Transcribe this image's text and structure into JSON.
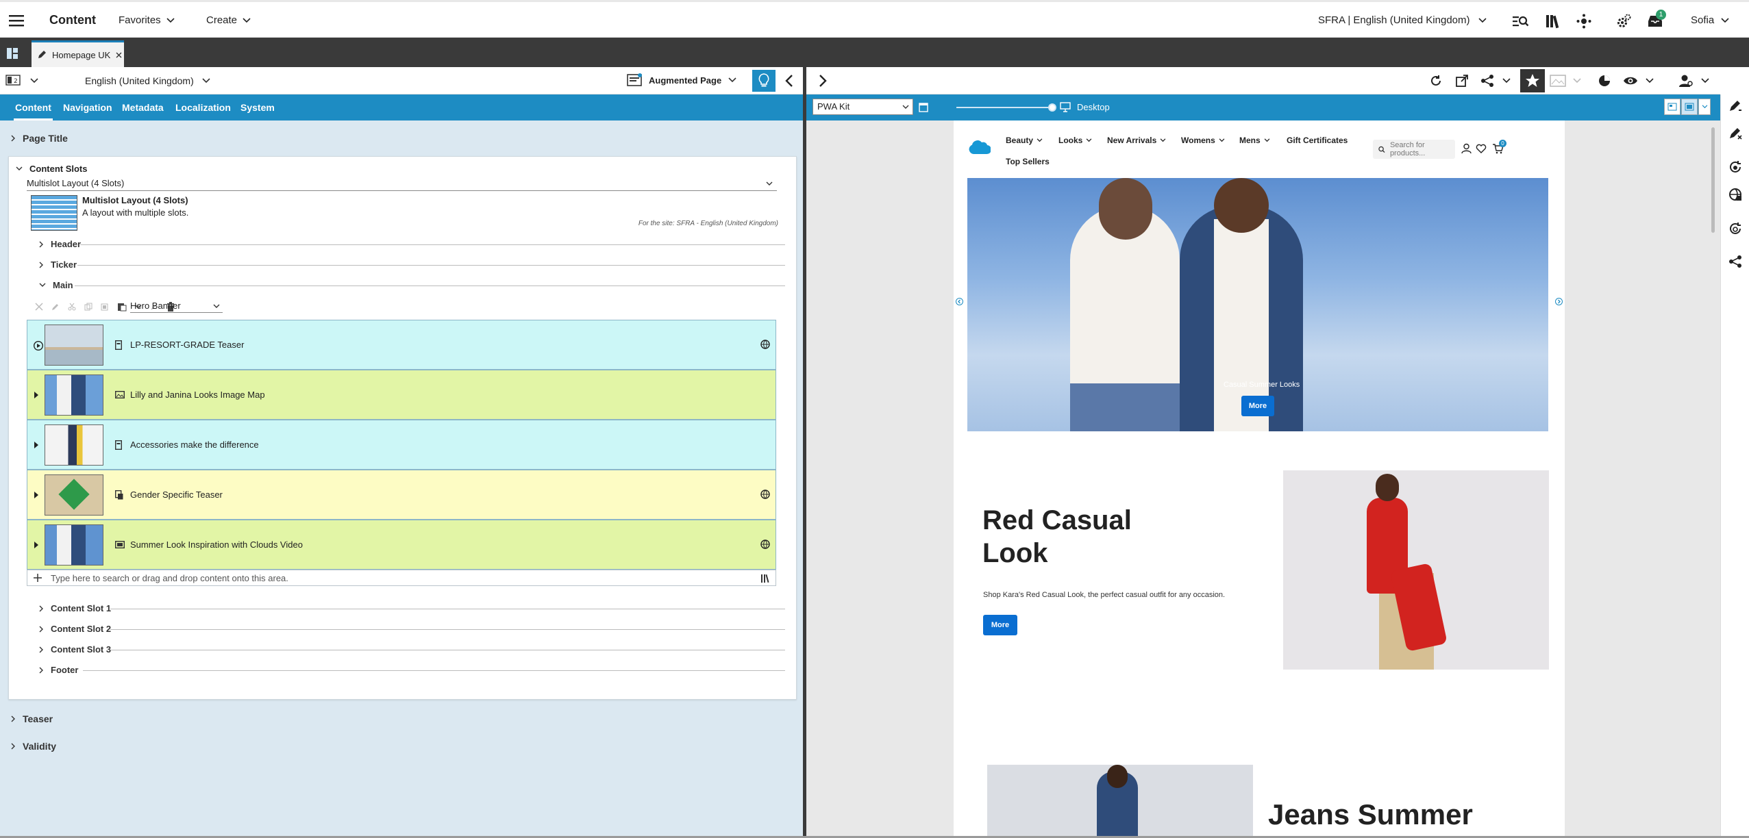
{
  "topbar": {
    "app_title": "Content",
    "favorites": "Favorites",
    "create": "Create",
    "site_locale": "SFRA | English (United Kingdom)",
    "user": "Sofia",
    "notif_count": "1"
  },
  "doc_tab": {
    "label": "Homepage UK"
  },
  "left": {
    "locale": "English (United Kingdom)",
    "augmented_page": "Augmented Page",
    "tabs": [
      "Content",
      "Navigation",
      "Metadata",
      "Localization",
      "System"
    ],
    "page_title_section": "Page Title",
    "content_slots_section": "Content Slots",
    "layout_select": "Multislot Layout (4 Slots)",
    "layout_name": "Multislot Layout (4 Slots)",
    "layout_desc": "A layout with multiple slots.",
    "site_note": "For the site: SFRA - English (United Kingdom)",
    "slots_top": [
      "Header",
      "Ticker",
      "Main"
    ],
    "component_select": "Hero Banner",
    "rows": [
      {
        "label": "LP-RESORT-GRADE Teaser",
        "color": "#ccf7f7"
      },
      {
        "label": "Lilly and Janina Looks Image Map",
        "color": "#e2f5a6"
      },
      {
        "label": "Accessories make the difference",
        "color": "#ccf7f7"
      },
      {
        "label": "Gender Specific Teaser",
        "color": "#fdfcc4"
      },
      {
        "label": "Summer Look Inspiration with Clouds Video",
        "color": "#e2f5a6"
      }
    ],
    "dropzone_placeholder": "Type here to search or drag and drop content onto this area.",
    "slots_bottom": [
      "Content Slot 1",
      "Content Slot 2",
      "Content Slot 3",
      "Footer"
    ],
    "teaser_section": "Teaser",
    "validity_section": "Validity"
  },
  "right": {
    "preview_select": "PWA Kit",
    "device": "Desktop",
    "zoom_level": 1.0,
    "site": {
      "nav": [
        "Beauty",
        "Looks",
        "New Arrivals",
        "Womens",
        "Mens",
        "Gift Certificates"
      ],
      "nav2": "Top Sellers",
      "search_placeholder": "Search for products...",
      "cart_count": "0",
      "hero_caption": "Casual Summer Looks",
      "hero_button": "More",
      "red_title_1": "Red Casual",
      "red_title_2": "Look",
      "red_desc": "Shop Kara's Red Casual Look, the perfect casual outfit for any occasion.",
      "red_button": "More",
      "jeans_title": "Jeans Summer"
    }
  },
  "colors": {
    "accent": "#1d8cc3",
    "dark_bar": "#3a3a3a",
    "pane_bg": "#dbe8f1",
    "site_blue": "#0a6ed1"
  }
}
